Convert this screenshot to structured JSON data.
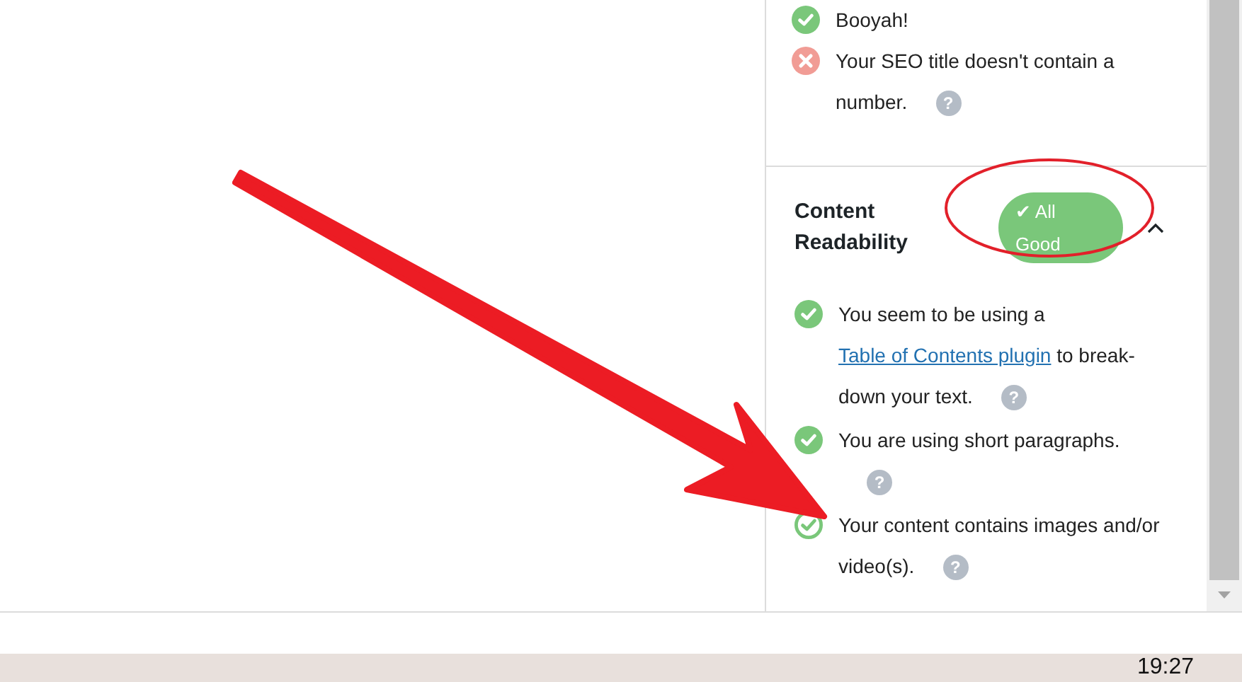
{
  "panel": {
    "previous_items": [
      {
        "text": "Booyah!",
        "kind": "pass"
      },
      {
        "text": "Your SEO title doesn't contain a number.",
        "kind": "fail",
        "help": "?"
      }
    ],
    "section": {
      "title": "Content Readability",
      "badge": "All Good",
      "badge_mark": "✔",
      "expanded": true,
      "items": [
        {
          "text": "You seem to be using a",
          "link": "Table of Contents plugin",
          "after": "to break-down your text.",
          "kind": "pass",
          "outlined": false,
          "help": "?"
        },
        {
          "text": "You are using short paragraphs.",
          "kind": "pass",
          "outlined": false,
          "help": "?"
        },
        {
          "text": "Your content contains images and/or video(s).",
          "kind": "pass",
          "outlined": true,
          "help": "?"
        }
      ]
    }
  },
  "taskbar": {
    "clock": "19:27"
  }
}
